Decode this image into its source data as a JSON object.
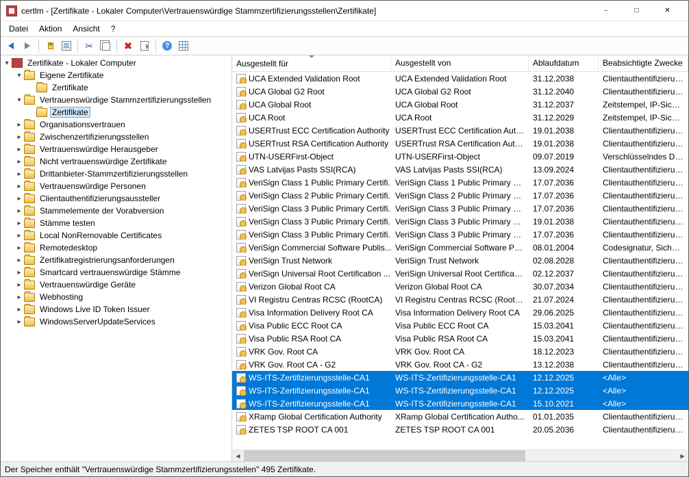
{
  "window": {
    "title": "certlm - [Zertifikate - Lokaler Computer\\Vertrauenswürdige Stammzertifizierungsstellen\\Zertifikate]"
  },
  "menu": {
    "file": "Datei",
    "action": "Aktion",
    "view": "Ansicht",
    "help": "?"
  },
  "tree": {
    "root": "Zertifikate - Lokaler Computer",
    "nodes": [
      {
        "label": "Eigene Zertifikate",
        "indent": 1,
        "expanded": true,
        "hasChildren": true
      },
      {
        "label": "Zertifikate",
        "indent": 2,
        "expanded": false,
        "hasChildren": false
      },
      {
        "label": "Vertrauenswürdige Stammzertifizierungsstellen",
        "indent": 1,
        "expanded": true,
        "hasChildren": true
      },
      {
        "label": "Zertifikate",
        "indent": 2,
        "expanded": false,
        "hasChildren": false,
        "selected": true
      },
      {
        "label": "Organisationsvertrauen",
        "indent": 1,
        "expanded": false,
        "hasChildren": true
      },
      {
        "label": "Zwischenzertifizierungsstellen",
        "indent": 1,
        "expanded": false,
        "hasChildren": true
      },
      {
        "label": "Vertrauenswürdige Herausgeber",
        "indent": 1,
        "expanded": false,
        "hasChildren": true
      },
      {
        "label": "Nicht vertrauenswürdige Zertifikate",
        "indent": 1,
        "expanded": false,
        "hasChildren": true
      },
      {
        "label": "Drittanbieter-Stammzertifizierungsstellen",
        "indent": 1,
        "expanded": false,
        "hasChildren": true
      },
      {
        "label": "Vertrauenswürdige Personen",
        "indent": 1,
        "expanded": false,
        "hasChildren": true
      },
      {
        "label": "Clientauthentifizierungsaussteller",
        "indent": 1,
        "expanded": false,
        "hasChildren": true
      },
      {
        "label": "Stammelemente der Vorabversion",
        "indent": 1,
        "expanded": false,
        "hasChildren": true
      },
      {
        "label": "Stämme testen",
        "indent": 1,
        "expanded": false,
        "hasChildren": true
      },
      {
        "label": "Local NonRemovable Certificates",
        "indent": 1,
        "expanded": false,
        "hasChildren": true
      },
      {
        "label": "Remotedesktop",
        "indent": 1,
        "expanded": false,
        "hasChildren": true
      },
      {
        "label": "Zertifikatregistrierungsanforderungen",
        "indent": 1,
        "expanded": false,
        "hasChildren": true
      },
      {
        "label": "Smartcard vertrauenswürdige Stämme",
        "indent": 1,
        "expanded": false,
        "hasChildren": true
      },
      {
        "label": "Vertrauenswürdige Geräte",
        "indent": 1,
        "expanded": false,
        "hasChildren": true
      },
      {
        "label": "Webhosting",
        "indent": 1,
        "expanded": false,
        "hasChildren": true
      },
      {
        "label": "Windows Live ID Token Issuer",
        "indent": 1,
        "expanded": false,
        "hasChildren": true
      },
      {
        "label": "WindowsServerUpdateServices",
        "indent": 1,
        "expanded": false,
        "hasChildren": true
      }
    ]
  },
  "columns": {
    "c0": "Ausgestellt für",
    "c1": "Ausgestellt von",
    "c2": "Ablaufdatum",
    "c3": "Beabsichtigte Zwecke"
  },
  "rows": [
    {
      "c0": "UCA Extended Validation Root",
      "c1": "UCA Extended Validation Root",
      "c2": "31.12.2038",
      "c3": "Clientauthentifizierung, C"
    },
    {
      "c0": "UCA Global G2 Root",
      "c1": "UCA Global G2 Root",
      "c2": "31.12.2040",
      "c3": "Clientauthentifizierung, C"
    },
    {
      "c0": "UCA Global Root",
      "c1": "UCA Global Root",
      "c2": "31.12.2037",
      "c3": "Zeitstempel, IP-Sicherheit"
    },
    {
      "c0": "UCA Root",
      "c1": "UCA Root",
      "c2": "31.12.2029",
      "c3": "Zeitstempel, IP-Sicherheit"
    },
    {
      "c0": "USERTrust ECC Certification Authority",
      "c1": "USERTrust ECC Certification Auth...",
      "c2": "19.01.2038",
      "c3": "Clientauthentifizierung, C"
    },
    {
      "c0": "USERTrust RSA Certification Authority",
      "c1": "USERTrust RSA Certification Auth...",
      "c2": "19.01.2038",
      "c3": "Clientauthentifizierung, C"
    },
    {
      "c0": "UTN-USERFirst-Object",
      "c1": "UTN-USERFirst-Object",
      "c2": "09.07.2019",
      "c3": "Verschlüsselndes Dateisys"
    },
    {
      "c0": "VAS Latvijas Pasts SSI(RCA)",
      "c1": "VAS Latvijas Pasts SSI(RCA)",
      "c2": "13.09.2024",
      "c3": "Clientauthentifizierung, C"
    },
    {
      "c0": "VeriSign Class 1 Public Primary Certifi...",
      "c1": "VeriSign Class 1 Public Primary Ce...",
      "c2": "17.07.2036",
      "c3": "Clientauthentifizierung, Si"
    },
    {
      "c0": "VeriSign Class 2 Public Primary Certifi...",
      "c1": "VeriSign Class 2 Public Primary Ce...",
      "c2": "17.07.2036",
      "c3": "Clientauthentifizierung, C"
    },
    {
      "c0": "VeriSign Class 3 Public Primary Certifi...",
      "c1": "VeriSign Class 3 Public Primary Ce...",
      "c2": "17.07.2036",
      "c3": "Clientauthentifizierung, C"
    },
    {
      "c0": "VeriSign Class 3 Public Primary Certifi...",
      "c1": "VeriSign Class 3 Public Primary Ce...",
      "c2": "19.01.2038",
      "c3": "Clientauthentifizierung, C"
    },
    {
      "c0": "VeriSign Class 3 Public Primary Certifi...",
      "c1": "VeriSign Class 3 Public Primary Ce...",
      "c2": "17.07.2036",
      "c3": "Clientauthentifizierung, C"
    },
    {
      "c0": "VeriSign Commercial Software Publis...",
      "c1": "VeriSign Commercial Software Pu...",
      "c2": "08.01.2004",
      "c3": "Codesignatur, Sichere E-M"
    },
    {
      "c0": "VeriSign Trust Network",
      "c1": "VeriSign Trust Network",
      "c2": "02.08.2028",
      "c3": "Clientauthentifizierung, C"
    },
    {
      "c0": "VeriSign Universal Root Certification ...",
      "c1": "VeriSign Universal Root Certificati...",
      "c2": "02.12.2037",
      "c3": "Clientauthentifizierung, C"
    },
    {
      "c0": "Verizon Global Root CA",
      "c1": "Verizon Global Root CA",
      "c2": "30.07.2034",
      "c3": "Clientauthentifizierung, C"
    },
    {
      "c0": "VI Registru Centras RCSC (RootCA)",
      "c1": "VI Registru Centras RCSC (RootCA)",
      "c2": "21.07.2024",
      "c3": "Clientauthentifizierung, C"
    },
    {
      "c0": "Visa Information Delivery Root CA",
      "c1": "Visa Information Delivery Root CA",
      "c2": "29.06.2025",
      "c3": "Clientauthentifizierung, Si"
    },
    {
      "c0": "Visa Public ECC Root CA",
      "c1": "Visa Public ECC Root CA",
      "c2": "15.03.2041",
      "c3": "Clientauthentifizierung, Se"
    },
    {
      "c0": "Visa Public RSA Root CA",
      "c1": "Visa Public RSA Root CA",
      "c2": "15.03.2041",
      "c3": "Clientauthentifizierung, Se"
    },
    {
      "c0": "VRK Gov. Root CA",
      "c1": "VRK Gov. Root CA",
      "c2": "18.12.2023",
      "c3": "Clientauthentifizierung, D"
    },
    {
      "c0": "VRK Gov. Root CA - G2",
      "c1": "VRK Gov. Root CA - G2",
      "c2": "13.12.2038",
      "c3": "Clientauthentifizierung, D"
    },
    {
      "c0": "WS-ITS-Zertifizierungsstelle-CA1",
      "c1": "WS-ITS-Zertifizierungsstelle-CA1",
      "c2": "12.12.2025",
      "c3": "<Alle>",
      "selected": true
    },
    {
      "c0": "WS-ITS-Zertifizierungsstelle-CA1",
      "c1": "WS-ITS-Zertifizierungsstelle-CA1",
      "c2": "12.12.2025",
      "c3": "<Alle>",
      "selected": true
    },
    {
      "c0": "WS-ITS-Zertifizierungsstelle-CA1",
      "c1": "WS-ITS-Zertifizierungsstelle-CA1",
      "c2": "15.10.2021",
      "c3": "<Alle>",
      "selected": true
    },
    {
      "c0": "XRamp Global Certification Authority",
      "c1": "XRamp Global Certification Autho...",
      "c2": "01.01.2035",
      "c3": "Clientauthentifizierung, C"
    },
    {
      "c0": "ZETES TSP ROOT CA 001",
      "c1": "ZETES TSP ROOT CA 001",
      "c2": "20.05.2036",
      "c3": "Clientauthentifizierung, D"
    }
  ],
  "status": {
    "text": "Der Speicher enthält \"Vertrauenswürdige Stammzertifizierungsstellen\" 495 Zertifikate."
  }
}
